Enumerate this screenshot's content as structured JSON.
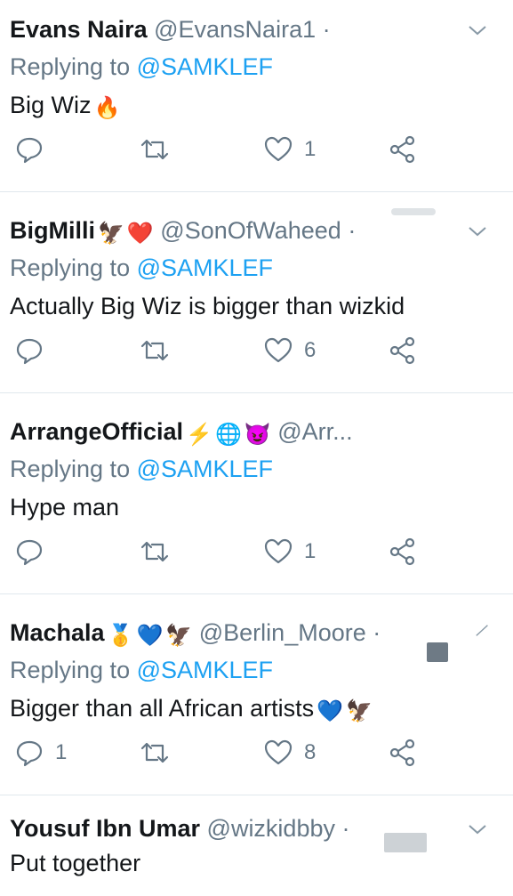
{
  "tweets": [
    {
      "name": "Evans Naira",
      "handle": "@EvansNaira1",
      "dot": "·",
      "name_emojis": [],
      "reply_prefix": "Replying to",
      "reply_to": "@SAMKLEF",
      "text": "Big Wiz",
      "text_emojis": [
        "🔥"
      ],
      "reply_count": "",
      "like_count": "1"
    },
    {
      "name": "BigMilli",
      "handle": "@SonOfWaheed",
      "dot": "·",
      "name_emojis": [
        "🦅",
        "❤️"
      ],
      "reply_prefix": "Replying to",
      "reply_to": "@SAMKLEF",
      "text": "Actually Big Wiz is bigger than wizkid",
      "text_emojis": [],
      "reply_count": "",
      "like_count": "6"
    },
    {
      "name": "ArrangeOfficial",
      "handle": "@Arr...",
      "dot": "",
      "name_emojis": [
        "⚡",
        "🌐",
        "😈"
      ],
      "reply_prefix": "Replying to",
      "reply_to": "@SAMKLEF",
      "text": "Hype man",
      "text_emojis": [],
      "reply_count": "",
      "like_count": "1"
    },
    {
      "name": "Machala",
      "handle": "@Berlin_Moore",
      "dot": "·",
      "name_emojis": [
        "🥇",
        "💙",
        "🦅"
      ],
      "reply_prefix": "Replying to",
      "reply_to": "@SAMKLEF",
      "text": "Bigger than all African artists",
      "text_emojis": [
        "💙",
        "🦅"
      ],
      "reply_count": "1",
      "like_count": "8"
    },
    {
      "name": "Yousuf Ibn Umar",
      "handle": "@wizkidbby",
      "dot": "·",
      "name_emojis": [],
      "reply_prefix": "",
      "reply_to": "",
      "text": "Put together",
      "text_emojis": [],
      "reply_count": "",
      "like_count": ""
    }
  ],
  "icons": {
    "reply": "reply-icon",
    "retweet": "retweet-icon",
    "like": "heart-icon",
    "share": "share-icon",
    "menu": "chevron-down-icon"
  },
  "colors": {
    "link": "#1da1f2",
    "muted": "#657786",
    "text": "#14171a",
    "divider": "#e1e8ed"
  }
}
